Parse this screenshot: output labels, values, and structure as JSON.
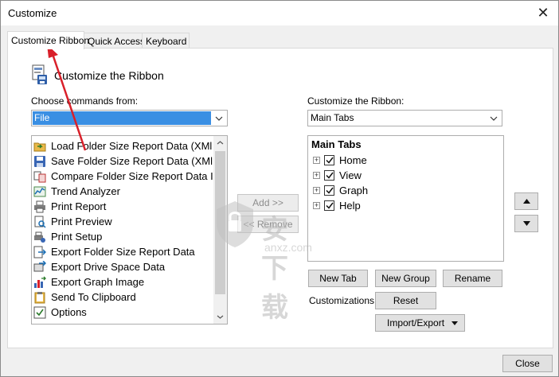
{
  "window": {
    "title": "Customize"
  },
  "tabs": [
    {
      "label": "Customize Ribbon",
      "active": true
    },
    {
      "label": "Quick Access",
      "active": false
    },
    {
      "label": "Keyboard",
      "active": false
    }
  ],
  "header": {
    "title": "Customize the Ribbon"
  },
  "left": {
    "label": "Choose commands from:",
    "dropdown_value": "File",
    "commands": [
      {
        "label": "Load Folder Size Report Data (XMl",
        "icon": "load-report-icon"
      },
      {
        "label": "Save Folder Size Report Data (XMl",
        "icon": "save-report-icon"
      },
      {
        "label": "Compare Folder Size Report Data I",
        "icon": "compare-report-icon"
      },
      {
        "label": "Trend Analyzer",
        "icon": "trend-analyzer-icon"
      },
      {
        "label": "Print Report",
        "icon": "printer-icon"
      },
      {
        "label": "Print Preview",
        "icon": "print-preview-icon"
      },
      {
        "label": "Print Setup",
        "icon": "print-setup-icon"
      },
      {
        "label": "Export Folder Size Report Data",
        "icon": "export-report-icon"
      },
      {
        "label": "Export Drive Space Data",
        "icon": "export-drive-icon"
      },
      {
        "label": "Export Graph Image",
        "icon": "export-graph-icon"
      },
      {
        "label": "Send To Clipboard",
        "icon": "clipboard-icon"
      },
      {
        "label": "Options",
        "icon": "options-icon"
      }
    ]
  },
  "middle": {
    "add_label": "Add >>",
    "remove_label": "<< Remove"
  },
  "right": {
    "label": "Customize the Ribbon:",
    "dropdown_value": "Main Tabs",
    "tree_title": "Main Tabs",
    "tree_items": [
      {
        "label": "Home",
        "checked": true
      },
      {
        "label": "View",
        "checked": true
      },
      {
        "label": "Graph",
        "checked": true
      },
      {
        "label": "Help",
        "checked": true
      }
    ],
    "new_tab_label": "New Tab",
    "new_group_label": "New Group",
    "rename_label": "Rename",
    "customizations_label": "Customizations:",
    "reset_label": "Reset",
    "import_export_label": "Import/Export"
  },
  "footer": {
    "close_label": "Close"
  },
  "watermark": {
    "text": "安下载",
    "url": "anxz.com"
  },
  "colors": {
    "selection": "#3a8fe3",
    "arrow": "#d9202a"
  }
}
